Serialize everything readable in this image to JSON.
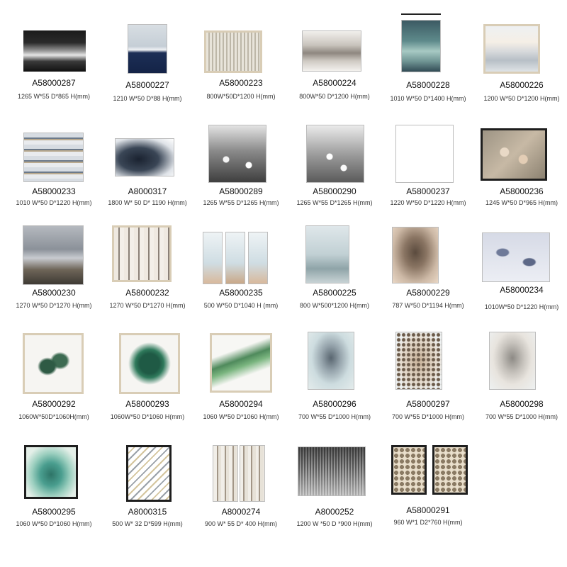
{
  "products": [
    {
      "code": "A58000287",
      "dims": "1265 W*55 D*865 H(mm)"
    },
    {
      "code": "A58000227",
      "dims": "1210 W*50 D*88 H(mm)"
    },
    {
      "code": "A58000223",
      "dims": "800W*50D*1200 H(mm)"
    },
    {
      "code": "A58000224",
      "dims": "800W*50 D*1200 H(mm)"
    },
    {
      "code": "A58000228",
      "dims": "1010 W*50 D*1400 H(mm)"
    },
    {
      "code": "A58000226",
      "dims": "1200 W*50 D*1200 H(mm)"
    },
    {
      "code": "A58000233",
      "dims": "1010 W*50 D*1220 H(mm)"
    },
    {
      "code": "A8000317",
      "dims": "1800 W* 50 D* 1190 H(mm)"
    },
    {
      "code": "A58000289",
      "dims": "1265 W*55 D*1265 H(mm)"
    },
    {
      "code": "A58000290",
      "dims": "1265 W*55 D*1265 H(mm)"
    },
    {
      "code": "A58000237",
      "dims": "1220 W*50 D*1220 H(mm)"
    },
    {
      "code": "A58000236",
      "dims": "1245 W*50 D*965 H(mm)"
    },
    {
      "code": "A58000230",
      "dims": "1270 W*50 D*1270 H(mm)"
    },
    {
      "code": "A58000232",
      "dims": "1270 W*50 D*1270 H(mm)"
    },
    {
      "code": "A58000235",
      "dims": "500 W*50 D*1040 H (mm)"
    },
    {
      "code": "A58000225",
      "dims": "800 W*500*1200 H(mm)"
    },
    {
      "code": "A58000229",
      "dims": "787 W*50 D*1194 H(mm)"
    },
    {
      "code": "A58000234",
      "dims": "1010W*50 D*1220 H(mm)"
    },
    {
      "code": "A58000292",
      "dims": "1060W*50D*1060H(mm)"
    },
    {
      "code": "A58000293",
      "dims": "1060W*50 D*1060 H(mm)"
    },
    {
      "code": "A58000294",
      "dims": "1060 W*50 D*1060 H(mm)"
    },
    {
      "code": "A58000296",
      "dims": "700 W*55 D*1000 H(mm)"
    },
    {
      "code": "A58000297",
      "dims": "700 W*55 D*1000 H(mm)"
    },
    {
      "code": "A58000298",
      "dims": "700 W*55 D*1000 H(mm)"
    },
    {
      "code": "A58000295",
      "dims": "1060 W*50 D*1060 H(mm)"
    },
    {
      "code": "A8000315",
      "dims": "500 W* 32 D*599 H(mm)"
    },
    {
      "code": "A8000274",
      "dims": "900 W* 55 D* 400 H(mm)"
    },
    {
      "code": "A8000252",
      "dims": "1200 W *50 D *900 H(mm)"
    },
    {
      "code": "A58000291",
      "dims": "960 W*1 D2*760 H(mm)"
    }
  ]
}
